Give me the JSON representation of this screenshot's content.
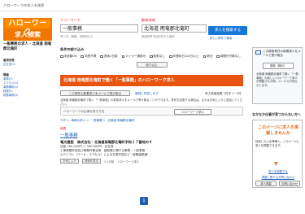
{
  "topbar": {
    "title": "ハローワークの求人を検索"
  },
  "logo": {
    "line1": "ハローワーク",
    "line2": "求人検索"
  },
  "search": {
    "freeword_label": "フリーワード",
    "freeword_value": "一般事務",
    "freeword_hint": "求人名、職種、勤務地など",
    "area_label": "勤務地域",
    "area_value": "北海道 雨竜郡北竜町",
    "area_hint": "都道府県市区町村から選択",
    "search_button": "求人を検索する",
    "links": "詳しい条件で検索"
  },
  "sidebar": {
    "title": "一般事務の求人 - 北海道 雨竜郡北竜町",
    "sections": [
      {
        "head": "雇用形態",
        "items": [
          "正社員(0)"
        ]
      },
      {
        "head": "職種",
        "items": [
          "事務(1)",
          "エクセル(1)",
          "事務補助(1)",
          "経理(0)",
          "総務事務(0)"
        ]
      }
    ]
  },
  "conditions": {
    "title": "条件の絞り込み",
    "checks": [
      "未経験OK",
      "学歴不問",
      "週休2日制",
      "マイカー通勤可",
      "転勤なし",
      "年間休日120日以上",
      "駅近",
      "時間外労働なし"
    ],
    "button": "絞り込む"
  },
  "banner": {
    "text": "北海道 雨竜郡北竜町で働く「一般事務」のハローワーク求人"
  },
  "mail": {
    "button": "この条件の新着求人をメールで受け取る",
    "link": "登録に同意します",
    "count": "求人検索結果 1件中 1~1件",
    "note": "北海道 雨竜郡北竜町で働く「一般事務」の新着求人をメールで受け取ることができます。条件を変更する場合は、またはお気に入りに追加してください。"
  },
  "memo": {
    "text": "ハローワークの仕事を探す方法",
    "button": "ハローワーク求人"
  },
  "breadcrumbs": [
    "TOP",
    "事務の求人",
    "一般事務",
    "北海道 雨竜郡北竜町"
  ],
  "result": {
    "badge": "新着",
    "title": "一般事務",
    "company": "竜光建設　株式会社・北海道雨竜郡北竜町字和１７番地の４",
    "lines": [
      "月給 160,000円 〜 330,000円・正社員",
      "工事書類作成及び事務作業全般　建設業に関する事務・一般事務",
      "◎パソコン（ワード・エクセル）による文書作成など・経験者優遇"
    ],
    "footer": [
      "お気に入り",
      "詳細を見る",
      "1ヶ月前",
      "ハローワーク求人"
    ]
  },
  "pager": {
    "page": "1"
  },
  "right": {
    "box1_title": "この検索条件の新着求人をメールで受け取る",
    "box1_button": "登録（無料）",
    "box1_desc": "北海道 雨竜郡北竜町で働く「一般事務」の新しいハローワーク求人が掲載された時、メールでお知らせします。",
    "section2_title": "なかなか仕事が見つからない方へ",
    "box2_big": "このページに求人を掲載しませんか",
    "box2_desc": "採用したい企業様へ。このページに求人を掲載できます。",
    "box2_link1": "求人を掲載する",
    "box2_link2": "掲載に関するお問い合わせ",
    "btn1": "求人掲載",
    "btn2": "お問い合わせ"
  }
}
